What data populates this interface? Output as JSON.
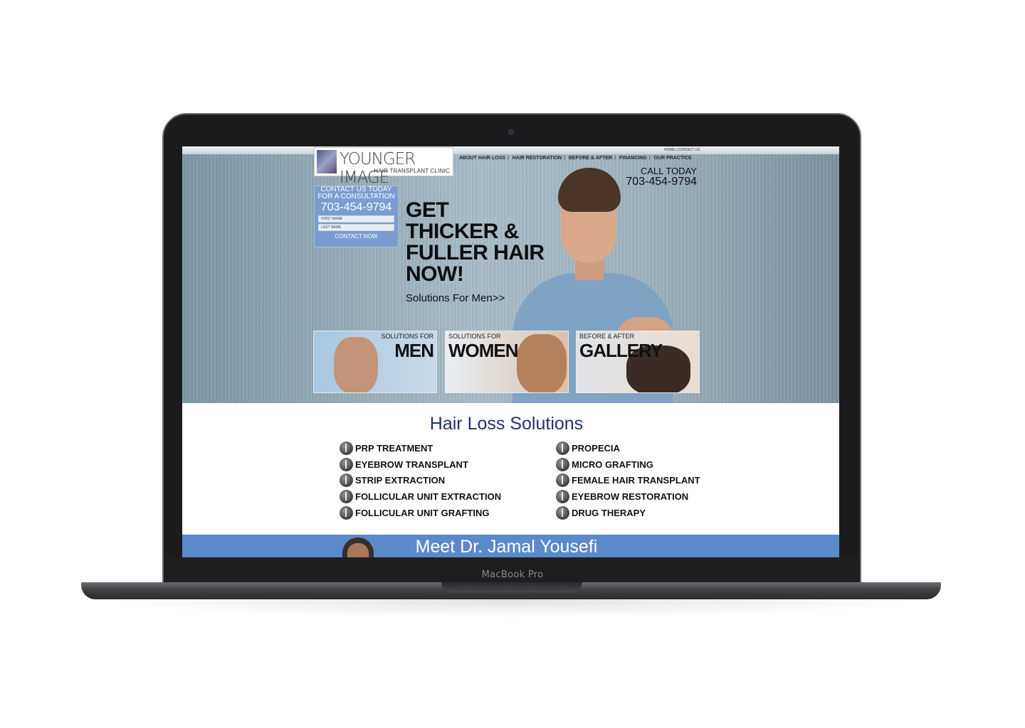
{
  "device": {
    "model_label": "MacBook Pro"
  },
  "site": {
    "top_links": [
      "HOME",
      "CONTACT US"
    ],
    "logo": {
      "title": "YOUNGER IMAGE",
      "subtitle": "HAIR TRANSPLANT CLINIC"
    },
    "nav": [
      "ABOUT HAIR LOSS",
      "HAIR RESTORATION",
      "BEFORE & AFTER",
      "FINANCING",
      "OUR PRACTICE"
    ],
    "call": {
      "label": "CALL TODAY",
      "phone": "703-454-9794"
    },
    "contact_box": {
      "line1": "CONTACT US TODAY",
      "line2": "FOR A CONSULTATION",
      "phone": "703-454-9794",
      "first_name_placeholder": "FIRST NAME",
      "last_name_placeholder": "LAST NAME",
      "button": "CONTACT NOW"
    },
    "hero": {
      "headline_lines": [
        "GET",
        "THICKER &",
        "FULLER HAIR",
        "NOW!"
      ],
      "link": "Solutions For Men>>"
    },
    "tiles": [
      {
        "small": "SOLUTIONS FOR",
        "big": "MEN"
      },
      {
        "small": "SOLUTIONS FOR",
        "big": "WOMEN"
      },
      {
        "small": "BEFORE & AFTER",
        "big": "GALLERY"
      }
    ],
    "solutions": {
      "title": "Hair Loss Solutions",
      "left": [
        "PRP TREATMENT",
        "EYEBROW TRANSPLANT",
        "STRIP EXTRACTION",
        "FOLLICULAR UNIT EXTRACTION",
        "FOLLICULAR UNIT GRAFTING"
      ],
      "right": [
        "PROPECIA",
        "MICRO GRAFTING",
        "FEMALE HAIR TRANSPLANT",
        "EYEBROW RESTORATION",
        "DRUG THERAPY"
      ]
    },
    "meet": {
      "title": "Meet Dr. Jamal Yousefi"
    }
  }
}
